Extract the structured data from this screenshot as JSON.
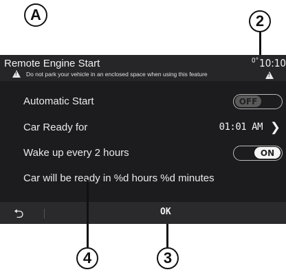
{
  "callouts": {
    "a": "A",
    "two": "2",
    "three": "3",
    "four": "4"
  },
  "screen": {
    "title": "Remote Engine Start",
    "status": {
      "temp_symbol": "0°",
      "time": "10:10"
    },
    "warning": "Do not park your vehicle in an enclosed space when using this feature",
    "rows": {
      "automatic_start": {
        "label": "Automatic Start",
        "toggle": "OFF"
      },
      "car_ready_for": {
        "label": "Car Ready for",
        "value": "01:01 AM"
      },
      "wake_up": {
        "label": "Wake up every 2 hours",
        "toggle": "ON"
      },
      "ready_message": {
        "label": "Car will be ready in %d hours %d minutes"
      }
    },
    "bottom_bar": {
      "back_icon": "back-arrow-icon",
      "ok_label": "OK"
    }
  }
}
